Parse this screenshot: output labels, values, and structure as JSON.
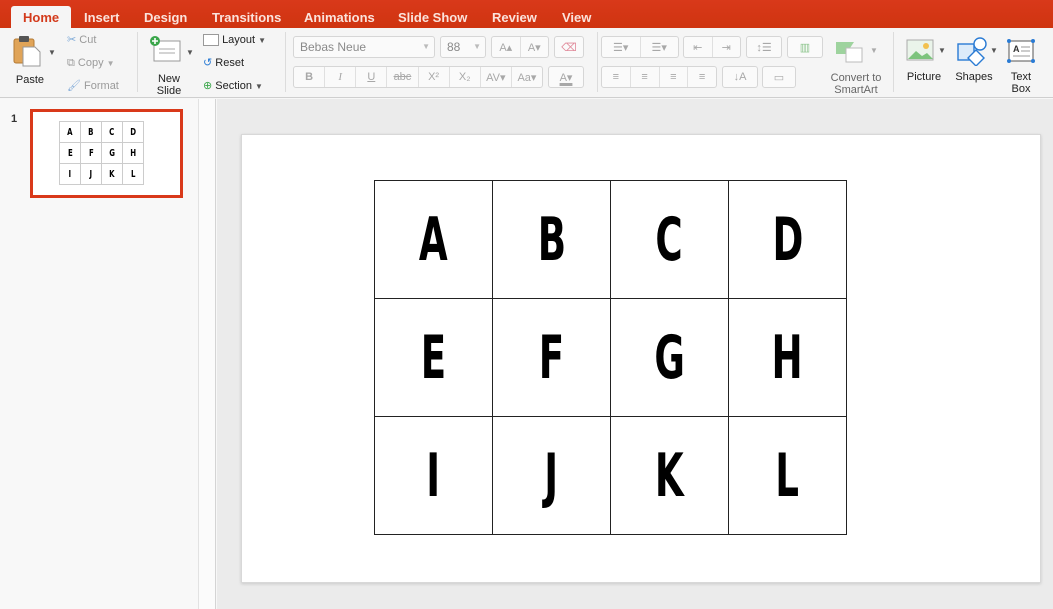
{
  "tabs": [
    {
      "label": "Home",
      "active": true
    },
    {
      "label": "Insert"
    },
    {
      "label": "Design"
    },
    {
      "label": "Transitions"
    },
    {
      "label": "Animations"
    },
    {
      "label": "Slide Show"
    },
    {
      "label": "Review"
    },
    {
      "label": "View"
    }
  ],
  "ribbon": {
    "paste": "Paste",
    "cut": "Cut",
    "copy": "Copy",
    "format": "Format",
    "new_slide_line1": "New",
    "new_slide_line2": "Slide",
    "layout": "Layout",
    "reset": "Reset",
    "section": "Section",
    "font_name": "Bebas Neue",
    "font_size": "88",
    "bold": "B",
    "italic": "I",
    "underline": "U",
    "strikethrough": "abc",
    "superscript": "X²",
    "subscript": "X₂",
    "convert_line1": "Convert to",
    "convert_line2": "SmartArt",
    "picture": "Picture",
    "shapes": "Shapes",
    "textbox_line1": "Text",
    "textbox_line2": "Box"
  },
  "slides_panel": {
    "slide_number": "1"
  },
  "slide": {
    "rows": [
      [
        "A",
        "B",
        "C",
        "D"
      ],
      [
        "E",
        "F",
        "G",
        "H"
      ],
      [
        "I",
        "J",
        "K",
        "L"
      ]
    ]
  },
  "colors": {
    "accent": "#d9391a"
  }
}
